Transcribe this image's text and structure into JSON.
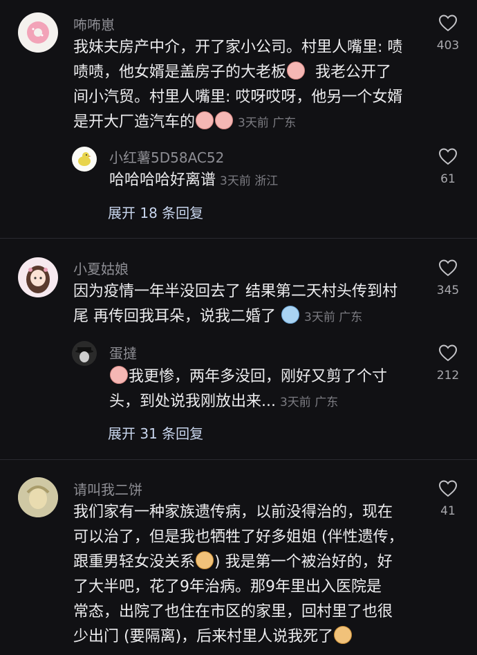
{
  "comments": [
    {
      "username": "咘咘崽",
      "text_lines": [
        "我妹夫房产中介，开了家小公司。村里人嘴里: 啧",
        "啧啧，他女婿是盖房子的大老板",
        "我老公开了",
        "间小汽贸。村里人嘴里: 哎呀哎呀，他另一个女婿",
        "是开大厂造汽车的"
      ],
      "meta": "3天前 广东",
      "likes": "403",
      "reply": {
        "username": "小红薯5D58AC52",
        "text": "哈哈哈哈好离谱",
        "meta": "3天前 浙江",
        "likes": "61"
      },
      "expand": "展开 18 条回复"
    },
    {
      "username": "小夏姑娘",
      "text_lines": [
        "因为疫情一年半没回去了 结果第二天村头传到村",
        "尾 再传回我耳朵，说我二婚了"
      ],
      "meta": "3天前 广东",
      "likes": "345",
      "reply": {
        "username": "蛋撻",
        "text_lines": [
          "我更惨，两年多没回，刚好又剪了个寸",
          "头，到处说我刚放出来..."
        ],
        "meta": "3天前 广东",
        "likes": "212"
      },
      "expand": "展开 31 条回复"
    },
    {
      "username": "请叫我二饼",
      "text_lines": [
        "我们家有一种家族遗传病，以前没得治的，现在",
        "可以治了，但是我也牺牲了好多姐姐 (伴性遗传，",
        "跟重男轻女没关系",
        ") 我是第一个被治好的，好",
        "了大半吧，花了9年治病。那9年里出入医院是",
        "常态，出院了也住在市区的家里，回村里了也很",
        "少出门 (要隔离)，后来村里人说我死了"
      ],
      "likes": "41"
    }
  ]
}
